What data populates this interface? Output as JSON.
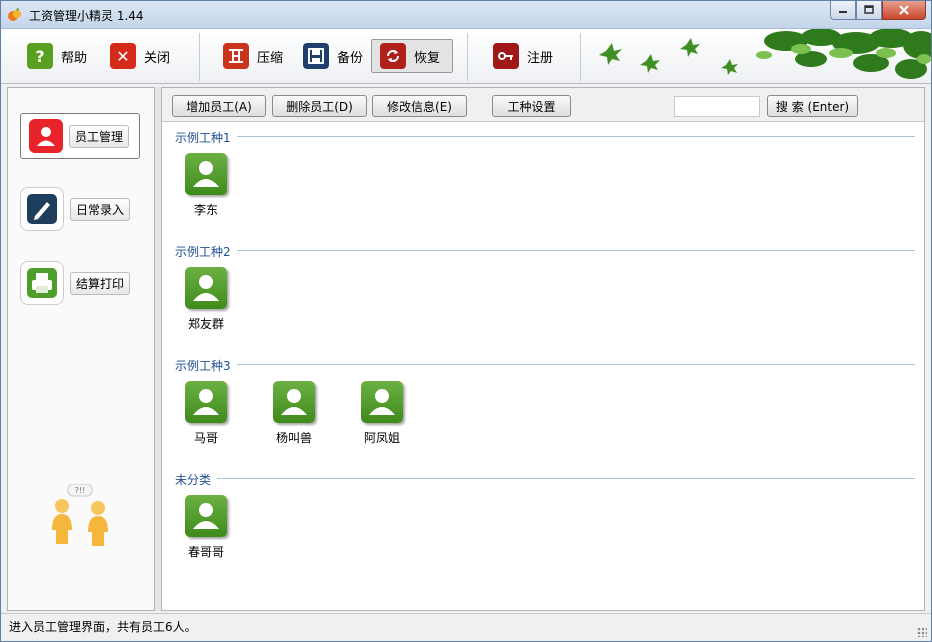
{
  "window": {
    "title": "工资管理小精灵 1.44"
  },
  "toolbar": {
    "help": "帮助",
    "close": "关闭",
    "compress": "压缩",
    "backup": "备份",
    "restore": "恢复",
    "register": "注册"
  },
  "sidebar": {
    "items": [
      {
        "label": "员工管理",
        "icon": "person-icon",
        "active": true
      },
      {
        "label": "日常录入",
        "icon": "pen-icon",
        "active": false
      },
      {
        "label": "结算打印",
        "icon": "printer-icon",
        "active": false
      }
    ],
    "illustration_text": "?!!"
  },
  "actions": {
    "add": "增加员工(A)",
    "delete": "删除员工(D)",
    "edit": "修改信息(E)",
    "work_types": "工种设置",
    "search_value": "",
    "search_button": "搜 索 (Enter)"
  },
  "groups": [
    {
      "name": "示例工种1",
      "employees": [
        "李东"
      ]
    },
    {
      "name": "示例工种2",
      "employees": [
        "郑友群"
      ]
    },
    {
      "name": "示例工种3",
      "employees": [
        "马哥",
        "杨叫兽",
        "阿凤姐"
      ]
    },
    {
      "name": "未分类",
      "employees": [
        "春哥哥"
      ]
    }
  ],
  "status": {
    "text": "进入员工管理界面，共有员工6人。"
  },
  "colors": {
    "employee_icon": "#4f9d2b",
    "help_icon": "#5aa020",
    "close_icon": "#d42a1a",
    "compress_icon": "#c8341c",
    "backup_icon": "#1f3f6e",
    "restore_icon": "#b0201a",
    "register_icon": "#a01818",
    "group_label": "#1f4f94"
  }
}
